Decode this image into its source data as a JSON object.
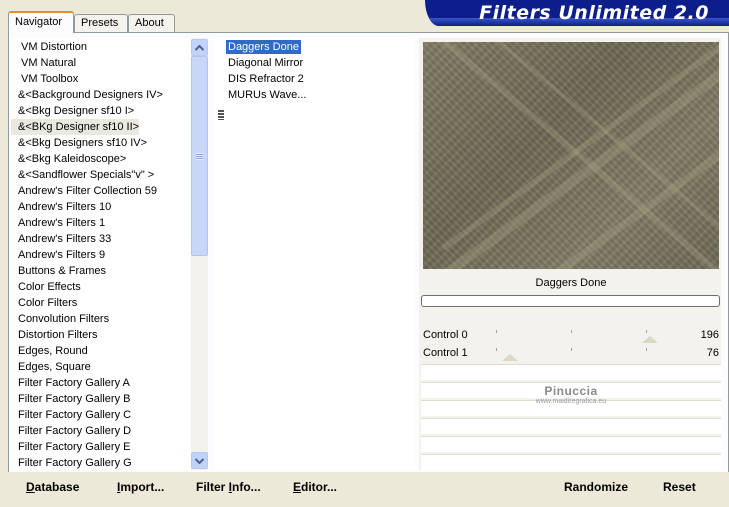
{
  "tabs": [
    {
      "label": "Navigator",
      "active": true
    },
    {
      "label": "Presets",
      "active": false
    },
    {
      "label": "About",
      "active": false
    }
  ],
  "banner": {
    "title": "Filters Unlimited 2.0"
  },
  "categories": [
    "VM Distortion",
    "VM Natural",
    "VM Toolbox",
    "&<Background Designers IV>",
    "&<Bkg Designer sf10 I>",
    "&<BKg Designer sf10 II>",
    "&<Bkg Designers sf10 IV>",
    "&<Bkg Kaleidoscope>",
    "&<Sandflower Specials\"v\" >",
    "Andrew's Filter Collection 59",
    "Andrew's Filters 10",
    "Andrew's Filters 1",
    "Andrew's Filters 33",
    "Andrew's Filters 9",
    "Buttons & Frames",
    "Color Effects",
    "Color Filters",
    "Convolution Filters",
    "Distortion Filters",
    "Edges, Round",
    "Edges, Square",
    "Filter Factory Gallery A",
    "Filter Factory Gallery B",
    "Filter Factory Gallery C",
    "Filter Factory Gallery D",
    "Filter Factory Gallery E",
    "Filter Factory Gallery G"
  ],
  "selected_category": "&<BKg Designer sf10 II>",
  "filters": [
    "Daggers Done",
    "Diagonal Mirror",
    "DIS Refractor 2",
    "MURUs Wave..."
  ],
  "selected_filter": "Daggers Done",
  "preview": {
    "filter_name": "Daggers Done"
  },
  "controls": [
    {
      "label": "Control 0",
      "value": 196
    },
    {
      "label": "Control  1",
      "value": 76
    }
  ],
  "watermark": {
    "title": "Pinuccia",
    "url": "www.maidiregrafica.eu"
  },
  "buttons": {
    "database": {
      "underline": "D",
      "rest": "atabase"
    },
    "import": {
      "underline": "I",
      "rest": "mport..."
    },
    "filter_info": {
      "pre": "Filter ",
      "underline": "I",
      "rest": "nfo..."
    },
    "editor": {
      "underline": "E",
      "rest": "ditor..."
    },
    "randomize": "Randomize",
    "reset": "Reset"
  },
  "colors": {
    "banner": "#0B1E8A",
    "selection": "#316AC5",
    "preview": "#7A7560"
  }
}
